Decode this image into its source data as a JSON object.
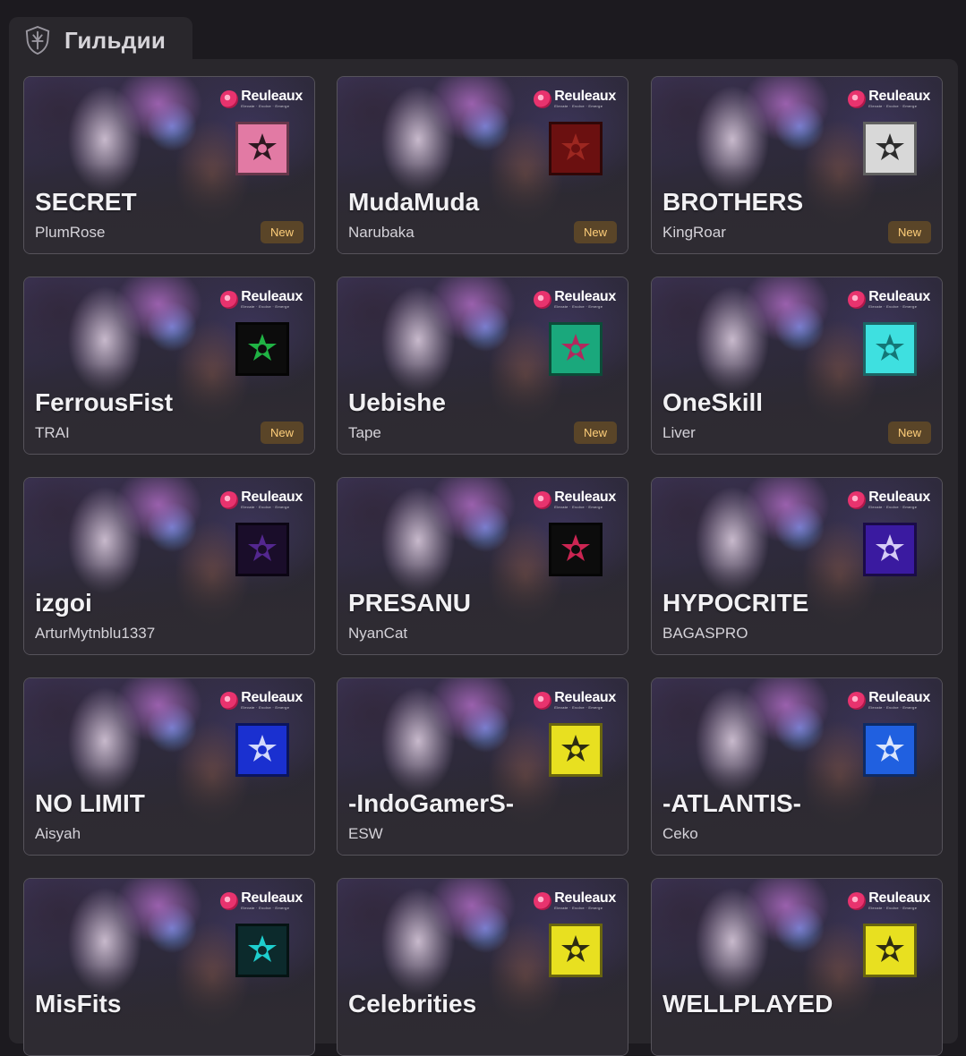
{
  "header": {
    "title": "Гильдии",
    "icon": "guild-shield-icon"
  },
  "brand": {
    "name": "Reuleaux",
    "tagline": "Elevate · Evolve · Emerge",
    "color": "#e8336e"
  },
  "guilds": [
    {
      "name": "SECRET",
      "leader": "PlumRose",
      "badge": "New",
      "emblem_bg": "#e27aa4",
      "emblem_fg": "#1a0d12"
    },
    {
      "name": "MudaMuda",
      "leader": "Narubaka",
      "badge": "New",
      "emblem_bg": "#6b1010",
      "emblem_fg": "#a22a22"
    },
    {
      "name": "BROTHERS",
      "leader": "KingRoar",
      "badge": "New",
      "emblem_bg": "#d8d8d8",
      "emblem_fg": "#1a1a1a"
    },
    {
      "name": "FerrousFist",
      "leader": "TRAI",
      "badge": "New",
      "emblem_bg": "#0c0c0c",
      "emblem_fg": "#22c54a"
    },
    {
      "name": "Uebishe",
      "leader": "Tape",
      "badge": "New",
      "emblem_bg": "#1aa87c",
      "emblem_fg": "#c21a5a"
    },
    {
      "name": "OneSkill",
      "leader": "Liver",
      "badge": "New",
      "emblem_bg": "#3ee0e0",
      "emblem_fg": "#0f6a6a"
    },
    {
      "name": "izgoi",
      "leader": "ArturMytnblu1337",
      "badge": "",
      "emblem_bg": "#1a0d2a",
      "emblem_fg": "#5a2a9a"
    },
    {
      "name": "PRESANU",
      "leader": "NyanCat",
      "badge": "",
      "emblem_bg": "#0c0c0c",
      "emblem_fg": "#e0285a"
    },
    {
      "name": "HYPOCRITE",
      "leader": "BAGASPRO",
      "badge": "",
      "emblem_bg": "#3a1aa0",
      "emblem_fg": "#e8e0ff"
    },
    {
      "name": "NO LIMIT",
      "leader": "Aisyah",
      "badge": "",
      "emblem_bg": "#1a30d0",
      "emblem_fg": "#e8ecff"
    },
    {
      "name": "-IndoGamerS-",
      "leader": "ESW",
      "badge": "",
      "emblem_bg": "#e8e020",
      "emblem_fg": "#1a1a10"
    },
    {
      "name": "-ATLANTIS-",
      "leader": "Ceko",
      "badge": "",
      "emblem_bg": "#2060e0",
      "emblem_fg": "#f0f4ff"
    },
    {
      "name": "MisFits",
      "leader": "",
      "badge": "",
      "emblem_bg": "#0c2a2c",
      "emblem_fg": "#20e0e0"
    },
    {
      "name": "Celebrities",
      "leader": "",
      "badge": "",
      "emblem_bg": "#e8e020",
      "emblem_fg": "#1a1a10"
    },
    {
      "name": "WELLPLAYED",
      "leader": "",
      "badge": "",
      "emblem_bg": "#e8e020",
      "emblem_fg": "#1a1a10"
    }
  ]
}
